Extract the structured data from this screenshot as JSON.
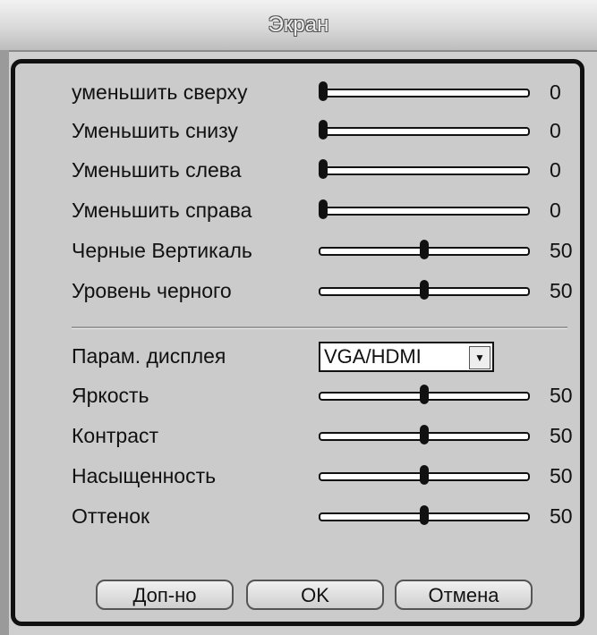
{
  "window": {
    "title": "Экран"
  },
  "sliders_top": [
    {
      "label": "уменьшить сверху",
      "value": "0",
      "level": 0
    },
    {
      "label": "Уменьшить снизу",
      "value": "0",
      "level": 0
    },
    {
      "label": "Уменьшить слева",
      "value": "0",
      "level": 0
    },
    {
      "label": "Уменьшить справа",
      "value": "0",
      "level": 0
    },
    {
      "label": "Черные Вертикаль",
      "value": "50",
      "level": 0.5
    },
    {
      "label": "Уровень черного",
      "value": "50",
      "level": 0.5
    }
  ],
  "display_param": {
    "label": "Парам. дисплея",
    "selected": "VGA/HDMI",
    "arrow_icon": "dropdown-arrow-icon"
  },
  "sliders_bottom": [
    {
      "label": "Яркость",
      "value": "50",
      "level": 0.5
    },
    {
      "label": "Контраст",
      "value": "50",
      "level": 0.5
    },
    {
      "label": "Насыщенность",
      "value": "50",
      "level": 0.5
    },
    {
      "label": "Оттенок",
      "value": "50",
      "level": 0.5
    }
  ],
  "buttons": {
    "advanced": "Доп-но",
    "ok": "OK",
    "cancel": "Отмена"
  }
}
